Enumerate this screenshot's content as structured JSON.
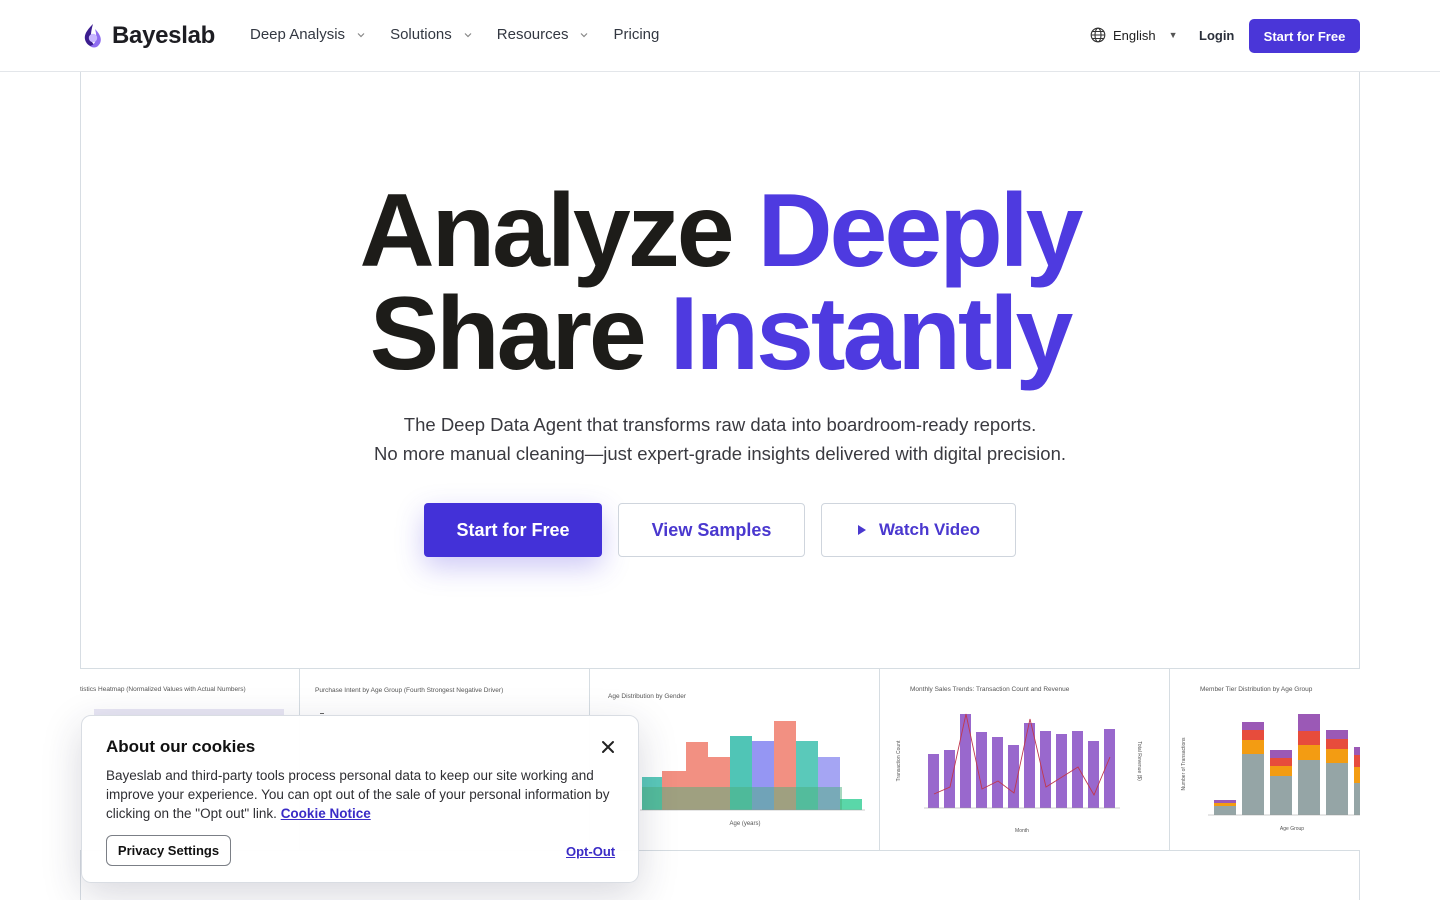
{
  "nav": {
    "brand": "Bayeslab",
    "links": [
      {
        "label": "Deep Analysis",
        "dropdown": true
      },
      {
        "label": "Solutions",
        "dropdown": true
      },
      {
        "label": "Resources",
        "dropdown": true
      },
      {
        "label": "Pricing",
        "dropdown": false
      }
    ],
    "language": "English",
    "login": "Login",
    "cta": "Start for Free"
  },
  "hero": {
    "line1_plain": "Analyze",
    "line1_accent": "Deeply",
    "line2_plain": "Share",
    "line2_accent": "Instantly",
    "sub_line1": "The Deep Data Agent that transforms raw data into boardroom-ready reports.",
    "sub_line2": "No more manual cleaning—just expert-grade insights delivered with digital precision.",
    "primary_cta": "Start for Free",
    "secondary_cta": "View Samples",
    "video_cta": "Watch Video"
  },
  "previews": {
    "panel1_title": "tistics Heatmap (Normalized Values with Actual Numbers)",
    "panel2_title": "Purchase Intent by Age Group (Fourth Strongest Negative Driver)",
    "panel3_title": "Age Distribution by Gender",
    "panel3_xlabel": "Age (years)",
    "panel4_title": "Monthly Sales Trends: Transaction Count and Revenue",
    "panel4_xlabel": "Month",
    "panel4_ylabel_left": "Transaction Count",
    "panel4_ylabel_right": "Total Revenue ($)",
    "panel5_title": "Member Tier Distribution by Age Group",
    "panel5_xlabel": "Age Group",
    "panel5_ylabel": "Number of Transactions"
  },
  "cookie": {
    "title": "About our cookies",
    "body": "Bayeslab and third-party tools process personal data to keep our site working and improve your experience. You can opt out of the sale of your personal information by clicking on the \"Opt out\" link.",
    "notice_link": "Cookie Notice",
    "privacy_button": "Privacy Settings",
    "optout": "Opt-Out"
  },
  "colors": {
    "accent": "#4e3ae0",
    "primary_button": "#4331d8",
    "heading": "#1d1c19"
  }
}
